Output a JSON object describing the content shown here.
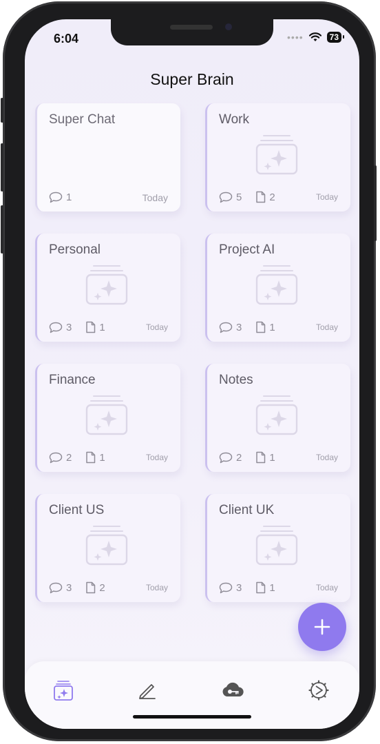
{
  "status_bar": {
    "time": "6:04",
    "battery": "73"
  },
  "app": {
    "title": "Super Brain"
  },
  "cards": [
    {
      "title": "Super Chat",
      "chats": "1",
      "files": "",
      "date": "Today"
    },
    {
      "title": "Work",
      "chats": "5",
      "files": "2",
      "date": "Today"
    },
    {
      "title": "Personal",
      "chats": "3",
      "files": "1",
      "date": "Today"
    },
    {
      "title": "Project AI",
      "chats": "3",
      "files": "1",
      "date": "Today"
    },
    {
      "title": "Finance",
      "chats": "2",
      "files": "1",
      "date": "Today"
    },
    {
      "title": "Notes",
      "chats": "2",
      "files": "1",
      "date": "Today"
    },
    {
      "title": "Client US",
      "chats": "3",
      "files": "2",
      "date": "Today"
    },
    {
      "title": "Client UK",
      "chats": "3",
      "files": "1",
      "date": "Today"
    }
  ],
  "tabs": [
    {
      "icon": "brain-stack-icon",
      "active": true
    },
    {
      "icon": "pen-icon",
      "active": false
    },
    {
      "icon": "cloud-key-icon",
      "active": false
    },
    {
      "icon": "settings-icon",
      "active": false
    }
  ],
  "colors": {
    "accent": "#8f7aee",
    "card_border": "#cbc1ef",
    "background": "#f0edf9"
  }
}
